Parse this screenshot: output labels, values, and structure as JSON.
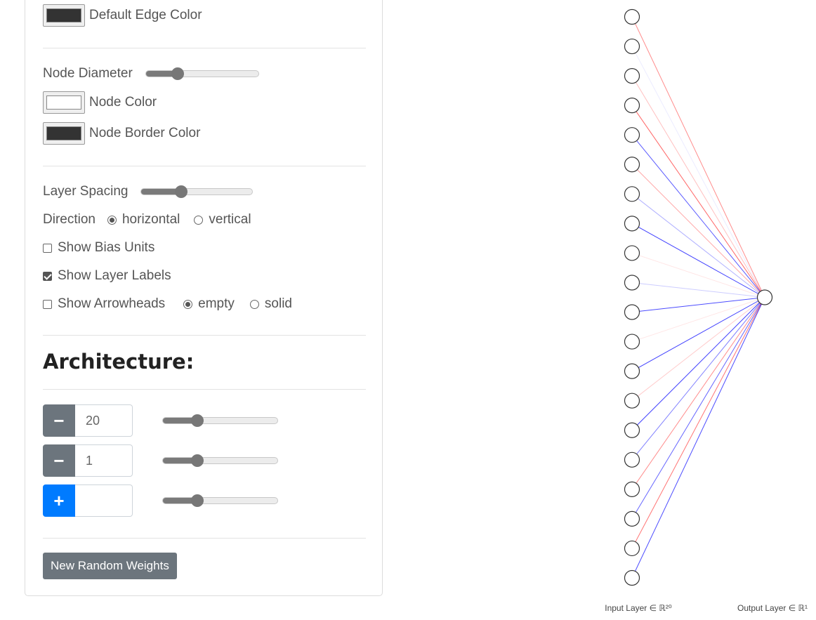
{
  "edge": {
    "default_color_label": "Default Edge Color",
    "default_color": "#333333"
  },
  "node": {
    "diameter_label": "Node Diameter",
    "diameter_level": 0.28,
    "color_label": "Node Color",
    "color": "#ffffff",
    "border_color_label": "Node Border Color",
    "border_color": "#333333"
  },
  "layout": {
    "spacing_label": "Layer Spacing",
    "spacing_level": 0.36,
    "direction_label": "Direction",
    "direction_options": [
      "horizontal",
      "vertical"
    ],
    "direction_selected": "horizontal"
  },
  "options": {
    "bias_label": "Show Bias Units",
    "bias_checked": false,
    "layer_labels_label": "Show Layer Labels",
    "layer_labels_checked": true,
    "arrowheads_label": "Show Arrowheads",
    "arrowheads_checked": false,
    "arrow_styles": [
      "empty",
      "solid"
    ],
    "arrow_style_selected": "empty"
  },
  "architecture": {
    "heading": "Architecture:",
    "layers": [
      {
        "button": "−",
        "value": "20",
        "level": 0.3
      },
      {
        "button": "−",
        "value": "1",
        "level": 0.3
      },
      {
        "button": "+",
        "value": "",
        "level": 0.3
      }
    ],
    "random_button": "New Random Weights"
  },
  "network": {
    "input_label": "Input Layer ∈ ℝ²⁰",
    "output_label": "Output Layer ∈ ℝ¹",
    "input_count": 20,
    "output_count": 1,
    "weights": [
      0.45,
      -0.05,
      0.25,
      0.6,
      -0.65,
      0.35,
      -0.3,
      -0.75,
      0.1,
      -0.2,
      -0.7,
      0.1,
      -0.75,
      0.2,
      -0.75,
      -0.5,
      0.45,
      -0.6,
      0.55,
      -0.7
    ],
    "positive_color": "#ff0000",
    "negative_color": "#0000ff"
  }
}
